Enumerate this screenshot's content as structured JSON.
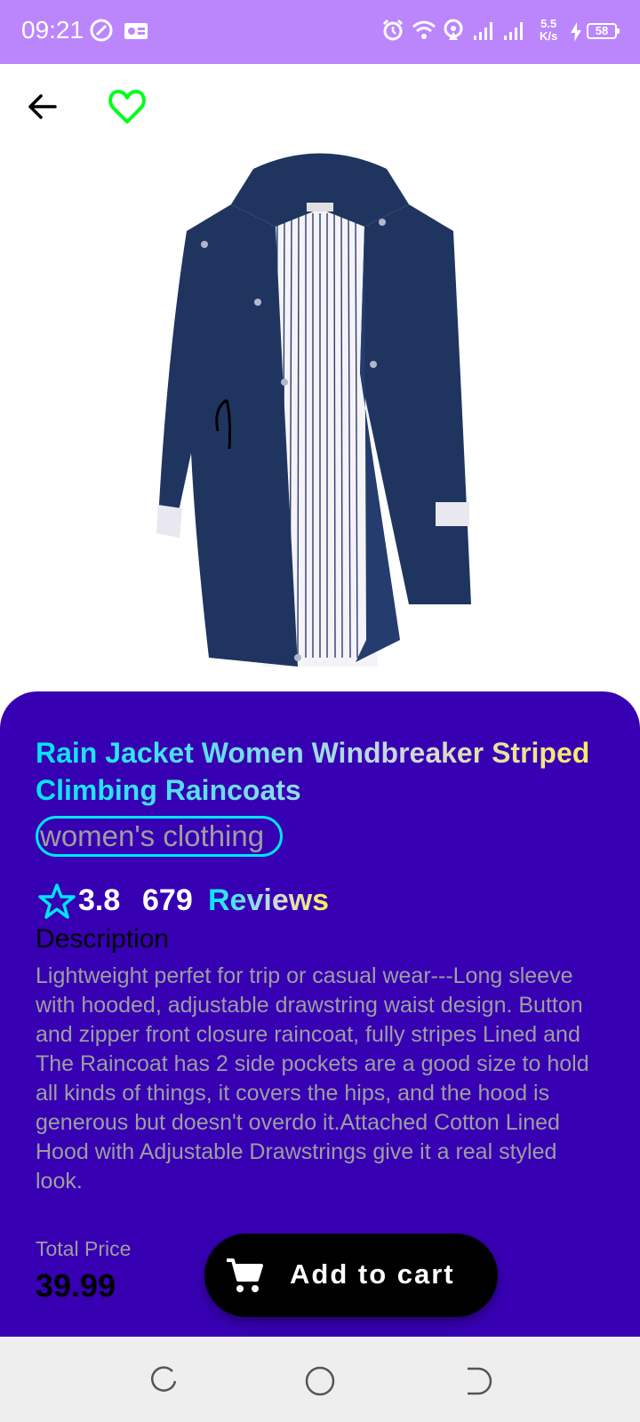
{
  "status_bar": {
    "time": "09:21",
    "network_speed_value": "5.5",
    "network_speed_unit": "K/s",
    "battery": "58",
    "background_color": "#bb86fc",
    "icons": [
      "data-saver-icon",
      "radio-icon",
      "alarm-icon",
      "wifi-icon",
      "hotspot-icon",
      "signal-icon",
      "signal-icon",
      "charging-icon",
      "battery-icon"
    ]
  },
  "toolbar": {
    "back_icon": "arrow-left-icon",
    "favorite_icon": "heart-outline-icon",
    "favorite_color": "#00ff1a"
  },
  "product": {
    "title": "Rain Jacket Women Windbreaker Striped Climbing Raincoats",
    "category": "women's clothing",
    "rating": "3.8",
    "review_count": "679",
    "review_label": "Reviews",
    "description_heading": "Description",
    "description": "Lightweight perfet for trip or casual wear---Long sleeve with hooded, adjustable drawstring waist design. Button and zipper front closure raincoat, fully stripes Lined and The Raincoat has 2 side pockets are a good size to hold all kinds of things, it covers the hips, and the hood is generous but doesn't overdo it.Attached Cotton Lined Hood with Adjustable Drawstrings give it a real styled look.",
    "price_label": "Total Price",
    "price": "39.99",
    "card_color": "#3700b3",
    "accent_color": "#00e5ff"
  },
  "cart": {
    "button_label": "Add to cart",
    "icon": "shopping-cart-icon"
  },
  "nav_bar": {
    "icons": [
      "recent-apps-icon",
      "home-icon",
      "back-nav-icon"
    ]
  }
}
